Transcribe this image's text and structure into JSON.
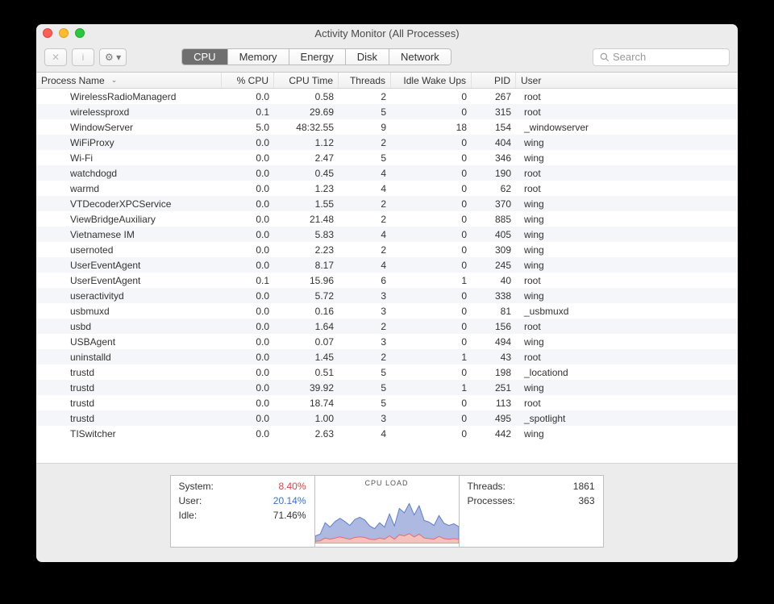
{
  "window": {
    "title": "Activity Monitor (All Processes)"
  },
  "toolbar": {
    "stop_label": "✕",
    "info_label": "i",
    "gear_label": "⚙ ▾"
  },
  "tabs": [
    {
      "label": "CPU",
      "active": true
    },
    {
      "label": "Memory",
      "active": false
    },
    {
      "label": "Energy",
      "active": false
    },
    {
      "label": "Disk",
      "active": false
    },
    {
      "label": "Network",
      "active": false
    }
  ],
  "search": {
    "placeholder": "Search"
  },
  "columns": {
    "process": "Process Name",
    "cpu": "% CPU",
    "time": "CPU Time",
    "threads": "Threads",
    "idle": "Idle Wake Ups",
    "pid": "PID",
    "user": "User"
  },
  "rows": [
    {
      "name": "WirelessRadioManagerd",
      "cpu": "0.0",
      "time": "0.58",
      "threads": "2",
      "idle": "0",
      "pid": "267",
      "user": "root"
    },
    {
      "name": "wirelessproxd",
      "cpu": "0.1",
      "time": "29.69",
      "threads": "5",
      "idle": "0",
      "pid": "315",
      "user": "root"
    },
    {
      "name": "WindowServer",
      "cpu": "5.0",
      "time": "48:32.55",
      "threads": "9",
      "idle": "18",
      "pid": "154",
      "user": "_windowserver"
    },
    {
      "name": "WiFiProxy",
      "cpu": "0.0",
      "time": "1.12",
      "threads": "2",
      "idle": "0",
      "pid": "404",
      "user": "wing"
    },
    {
      "name": "Wi-Fi",
      "cpu": "0.0",
      "time": "2.47",
      "threads": "5",
      "idle": "0",
      "pid": "346",
      "user": "wing"
    },
    {
      "name": "watchdogd",
      "cpu": "0.0",
      "time": "0.45",
      "threads": "4",
      "idle": "0",
      "pid": "190",
      "user": "root"
    },
    {
      "name": "warmd",
      "cpu": "0.0",
      "time": "1.23",
      "threads": "4",
      "idle": "0",
      "pid": "62",
      "user": "root"
    },
    {
      "name": "VTDecoderXPCService",
      "cpu": "0.0",
      "time": "1.55",
      "threads": "2",
      "idle": "0",
      "pid": "370",
      "user": "wing"
    },
    {
      "name": "ViewBridgeAuxiliary",
      "cpu": "0.0",
      "time": "21.48",
      "threads": "2",
      "idle": "0",
      "pid": "885",
      "user": "wing"
    },
    {
      "name": "Vietnamese IM",
      "cpu": "0.0",
      "time": "5.83",
      "threads": "4",
      "idle": "0",
      "pid": "405",
      "user": "wing"
    },
    {
      "name": "usernoted",
      "cpu": "0.0",
      "time": "2.23",
      "threads": "2",
      "idle": "0",
      "pid": "309",
      "user": "wing"
    },
    {
      "name": "UserEventAgent",
      "cpu": "0.0",
      "time": "8.17",
      "threads": "4",
      "idle": "0",
      "pid": "245",
      "user": "wing"
    },
    {
      "name": "UserEventAgent",
      "cpu": "0.1",
      "time": "15.96",
      "threads": "6",
      "idle": "1",
      "pid": "40",
      "user": "root"
    },
    {
      "name": "useractivityd",
      "cpu": "0.0",
      "time": "5.72",
      "threads": "3",
      "idle": "0",
      "pid": "338",
      "user": "wing"
    },
    {
      "name": "usbmuxd",
      "cpu": "0.0",
      "time": "0.16",
      "threads": "3",
      "idle": "0",
      "pid": "81",
      "user": "_usbmuxd"
    },
    {
      "name": "usbd",
      "cpu": "0.0",
      "time": "1.64",
      "threads": "2",
      "idle": "0",
      "pid": "156",
      "user": "root"
    },
    {
      "name": "USBAgent",
      "cpu": "0.0",
      "time": "0.07",
      "threads": "3",
      "idle": "0",
      "pid": "494",
      "user": "wing"
    },
    {
      "name": "uninstalld",
      "cpu": "0.0",
      "time": "1.45",
      "threads": "2",
      "idle": "1",
      "pid": "43",
      "user": "root"
    },
    {
      "name": "trustd",
      "cpu": "0.0",
      "time": "0.51",
      "threads": "5",
      "idle": "0",
      "pid": "198",
      "user": "_locationd"
    },
    {
      "name": "trustd",
      "cpu": "0.0",
      "time": "39.92",
      "threads": "5",
      "idle": "1",
      "pid": "251",
      "user": "wing"
    },
    {
      "name": "trustd",
      "cpu": "0.0",
      "time": "18.74",
      "threads": "5",
      "idle": "0",
      "pid": "113",
      "user": "root"
    },
    {
      "name": "trustd",
      "cpu": "0.0",
      "time": "1.00",
      "threads": "3",
      "idle": "0",
      "pid": "495",
      "user": "_spotlight"
    },
    {
      "name": "TISwitcher",
      "cpu": "0.0",
      "time": "2.63",
      "threads": "4",
      "idle": "0",
      "pid": "442",
      "user": "wing"
    }
  ],
  "summary": {
    "system_label": "System:",
    "system_value": "8.40%",
    "user_label": "User:",
    "user_value": "20.14%",
    "idle_label": "Idle:",
    "idle_value": "71.46%",
    "threads_label": "Threads:",
    "threads_value": "1861",
    "processes_label": "Processes:",
    "processes_value": "363",
    "chart_caption": "CPU LOAD"
  },
  "chart_data": {
    "type": "area",
    "title": "CPU LOAD",
    "xlabel": "",
    "ylabel": "",
    "ylim": [
      0,
      100
    ],
    "series": [
      {
        "name": "User",
        "color": "#5a7ed0",
        "values": [
          10,
          12,
          28,
          22,
          30,
          34,
          30,
          25,
          33,
          36,
          32,
          24,
          20,
          28,
          22,
          40,
          24,
          48,
          42,
          55,
          40,
          52,
          32,
          30,
          25,
          38,
          28,
          25,
          27,
          23
        ]
      },
      {
        "name": "System",
        "color": "#e26d6d",
        "values": [
          4,
          5,
          10,
          8,
          10,
          12,
          10,
          8,
          11,
          12,
          11,
          8,
          7,
          10,
          8,
          14,
          8,
          16,
          14,
          18,
          12,
          17,
          10,
          9,
          8,
          13,
          9,
          8,
          9,
          8
        ]
      }
    ]
  }
}
